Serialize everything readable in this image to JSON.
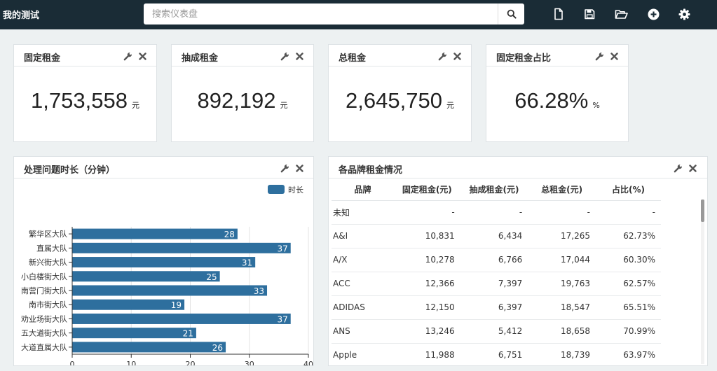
{
  "app": {
    "title": "我的测试"
  },
  "search": {
    "placeholder": "搜索仪表盘"
  },
  "toolbar": {
    "icons": [
      "search-icon",
      "new-file-icon",
      "save-icon",
      "open-folder-icon",
      "add-circle-icon",
      "gear-icon"
    ]
  },
  "kpis": [
    {
      "title": "固定租金",
      "value": "1,753,558",
      "unit": "元"
    },
    {
      "title": "抽成租金",
      "value": "892,192",
      "unit": "元"
    },
    {
      "title": "总租金",
      "value": "2,645,750",
      "unit": "元"
    },
    {
      "title": "固定租金占比",
      "value": "66.28%",
      "unit": "%"
    }
  ],
  "panel_icons": [
    "wrench-icon",
    "close-icon"
  ],
  "bar_panel": {
    "title": "处理问题时长（分钟）"
  },
  "chart_data": {
    "type": "bar",
    "orientation": "horizontal",
    "categories": [
      "繁华区大队",
      "直属大队",
      "新兴街大队",
      "小白楼街大队",
      "南营门街大队",
      "南市街大队",
      "劝业场街大队",
      "五大道街大队",
      "大道直属大队"
    ],
    "series": [
      {
        "name": "时长",
        "values": [
          28,
          37,
          31,
          25,
          33,
          19,
          37,
          21,
          26
        ],
        "color": "#2e6f9e"
      }
    ],
    "xlim": [
      0,
      40
    ],
    "xticks": [
      0,
      10,
      20,
      30,
      40
    ],
    "grid": true,
    "legend_position": "top-right",
    "data_labels": true
  },
  "table_panel": {
    "title": "各品牌租金情况",
    "columns": [
      "品牌",
      "固定租金(元)",
      "抽成租金(元)",
      "总租金(元)",
      "占比(%)"
    ],
    "rows": [
      [
        "未知",
        "-",
        "-",
        "-",
        "-"
      ],
      [
        "A&I",
        "10,831",
        "6,434",
        "17,265",
        "62.73%"
      ],
      [
        "A/X",
        "10,278",
        "6,766",
        "17,044",
        "60.30%"
      ],
      [
        "ACC",
        "12,366",
        "7,397",
        "19,763",
        "62.57%"
      ],
      [
        "ADIDAS",
        "12,150",
        "6,397",
        "18,547",
        "65.51%"
      ],
      [
        "ANS",
        "13,246",
        "5,412",
        "18,658",
        "70.99%"
      ],
      [
        "Apple",
        "11,988",
        "6,751",
        "18,739",
        "63.97%"
      ]
    ]
  }
}
